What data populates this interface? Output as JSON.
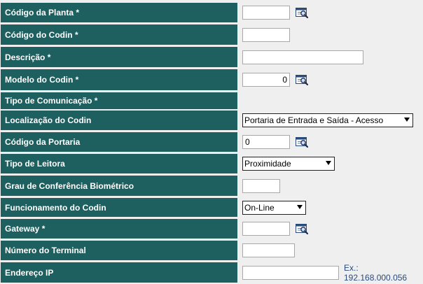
{
  "fields": {
    "codigo_planta": {
      "label": "Código da Planta *",
      "value": ""
    },
    "codigo_codin": {
      "label": "Código do Codin *",
      "value": ""
    },
    "descricao": {
      "label": "Descrição *",
      "value": ""
    },
    "modelo_codin": {
      "label": "Modelo do Codin *",
      "value": "0"
    },
    "tipo_comunicacao": {
      "label": "Tipo de Comunicação *"
    },
    "localizacao_codin": {
      "label": "Localização do Codin",
      "selected": "Portaria de Entrada e Saída - Acesso"
    },
    "codigo_portaria": {
      "label": "Código da Portaria",
      "value": "0"
    },
    "tipo_leitora": {
      "label": "Tipo de Leitora",
      "selected": "Proximidade"
    },
    "grau_biometrico": {
      "label": "Grau de Conferência Biométrico",
      "value": ""
    },
    "funcionamento_codin": {
      "label": "Funcionamento do Codin",
      "selected": "On-Line"
    },
    "gateway": {
      "label": "Gateway *",
      "value": ""
    },
    "numero_terminal": {
      "label": "Número do Terminal",
      "value": ""
    },
    "endereco_ip": {
      "label": "Endereço IP",
      "value": "",
      "hint": "Ex.: 192.168.000.056"
    }
  },
  "icons": {
    "lookup": "search-lookup-icon"
  },
  "colors": {
    "label_bg": "#1e5f5f",
    "label_text": "#ffffff",
    "page_bg": "#efefef",
    "hint_text": "#2a4a7a"
  }
}
